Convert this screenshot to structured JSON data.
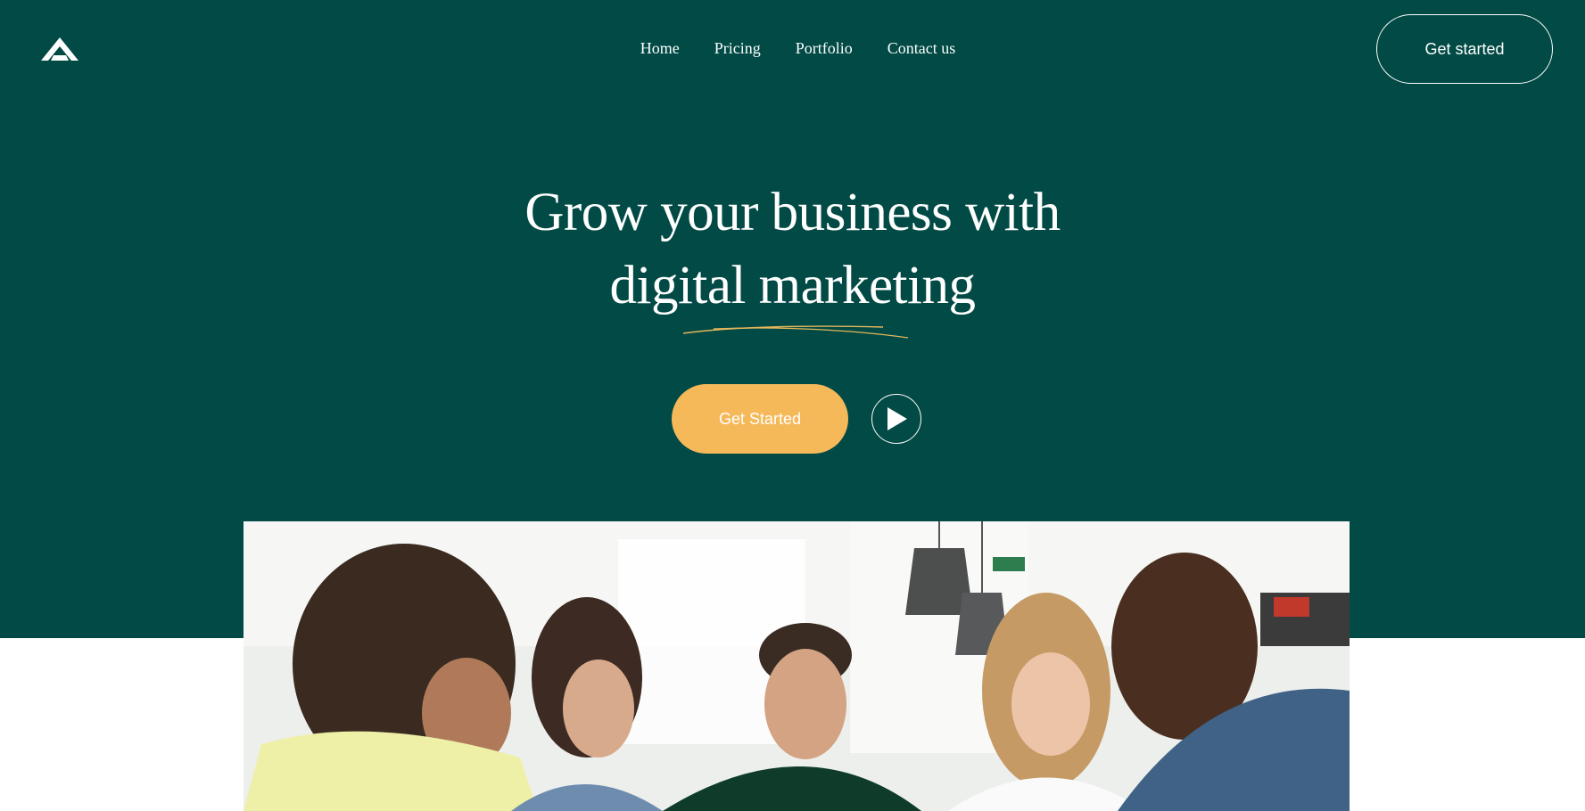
{
  "brand": {
    "logo_icon": "triangle-logo-icon"
  },
  "nav": {
    "links": [
      "Home",
      "Pricing",
      "Portfolio",
      "Contact us"
    ],
    "cta_label": "Get started"
  },
  "hero": {
    "headline_line1": "Grow your business with",
    "headline_line2": "digital marketing",
    "primary_cta_label": "Get Started",
    "play_icon": "play-icon",
    "image_description": "group-of-people-meeting-photo"
  },
  "colors": {
    "hero_background": "#014a45",
    "accent": "#f5b95a",
    "text_light": "#ffffff",
    "underline": "#e5b75a"
  }
}
